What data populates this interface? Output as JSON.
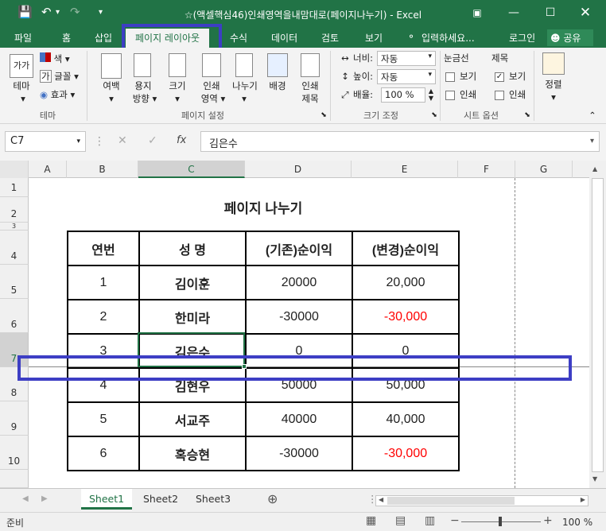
{
  "window": {
    "title": "☆(액셀핵심46)인쇄영역을내맘대로(페이지나누기) - Excel"
  },
  "tabs": [
    "파일",
    "홈",
    "삽입",
    "페이지 레이아웃",
    "수식",
    "데이터",
    "검토",
    "보기"
  ],
  "tell_me": "입력하세요...",
  "login": "로그인",
  "share": "공유",
  "ribbon": {
    "theme": {
      "themes": "테마",
      "colors": "색",
      "fonts": "글꼴",
      "effects": "효과",
      "group": "테마"
    },
    "page_setup": {
      "margins": "여백",
      "orientation": [
        "용지",
        "방향"
      ],
      "size": "크기",
      "print_area": [
        "인쇄",
        "영역"
      ],
      "breaks": "나누기",
      "background": "배경",
      "print_titles": [
        "인쇄",
        "제목"
      ],
      "group": "페이지 설정"
    },
    "scale": {
      "width_label": "너비:",
      "width_value": "자동",
      "height_label": "높이:",
      "height_value": "자동",
      "scale_label": "배율:",
      "scale_value": "100 %",
      "group": "크기 조정"
    },
    "sheet_options": {
      "gridlines": "눈금선",
      "headings": "제목",
      "view": "보기",
      "print": "인쇄",
      "group": "시트 옵션",
      "gridlines_view_checked": false,
      "gridlines_print_checked": false,
      "headings_view_checked": true,
      "headings_print_checked": false
    },
    "arrange": {
      "label": "정렬"
    }
  },
  "formula_bar": {
    "name_box": "C7",
    "content": "김은수"
  },
  "columns": [
    "A",
    "B",
    "C",
    "D",
    "E",
    "F",
    "G"
  ],
  "rows": [
    "1",
    "2",
    "3",
    "4",
    "5",
    "6",
    "7",
    "8",
    "9",
    "10"
  ],
  "sheet": {
    "title": "페이지  나누기",
    "headers": [
      "연번",
      "성   명",
      "(기존)순이익",
      "(변경)순이익"
    ],
    "data": [
      [
        "1",
        "김이훈",
        "20000",
        "20,000"
      ],
      [
        "2",
        "한미라",
        "-30000",
        "-30,000"
      ],
      [
        "3",
        "김은수",
        "0",
        "0"
      ],
      [
        "4",
        "김현우",
        "50000",
        "50,000"
      ],
      [
        "5",
        "서교주",
        "40000",
        "40,000"
      ],
      [
        "6",
        "혹승현",
        "-30000",
        "-30,000"
      ]
    ]
  },
  "sheet_tabs": [
    "Sheet1",
    "Sheet2",
    "Sheet3"
  ],
  "status": {
    "mode": "준비",
    "zoom": "100 %"
  },
  "colors": {
    "excel_green": "#217346",
    "highlight": "#3d3ec4",
    "negative": "#ff0000"
  }
}
